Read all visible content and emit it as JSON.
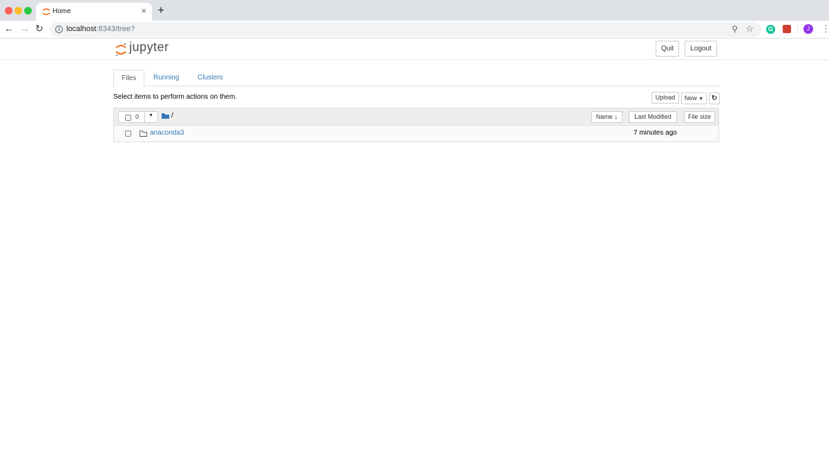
{
  "browser": {
    "tab_title": "Home",
    "tab_close": "×",
    "new_tab": "+",
    "url_host": "localhost",
    "url_rest": ":8343/tree?",
    "avatar_initial": "J",
    "ext_grammarly": "G",
    "icons": [
      "back-arrow-icon",
      "forward-arrow-icon",
      "reload-icon",
      "info-icon",
      "zoom-icon",
      "star-icon",
      "grammarly-icon",
      "extension-icon",
      "kebab-menu-icon"
    ]
  },
  "header": {
    "logo_text": "jupyter",
    "quit_label": "Quit",
    "logout_label": "Logout"
  },
  "tabs": [
    {
      "label": "Files",
      "active": true
    },
    {
      "label": "Running",
      "active": false
    },
    {
      "label": "Clusters",
      "active": false
    }
  ],
  "files": {
    "instructions": "Select items to perform actions on them.",
    "upload_label": "Upload",
    "new_label": "New",
    "selected_count": "0",
    "path": "/",
    "columns": {
      "name": "Name",
      "last_modified": "Last Modified",
      "file_size": "File size"
    },
    "items": [
      {
        "name": "anaconda3",
        "type": "folder",
        "modified": "7 minutes ago"
      }
    ]
  },
  "colors": {
    "link": "#337ab7",
    "logo_orange": "#f37726",
    "tabstrip": "#dee1e6"
  }
}
